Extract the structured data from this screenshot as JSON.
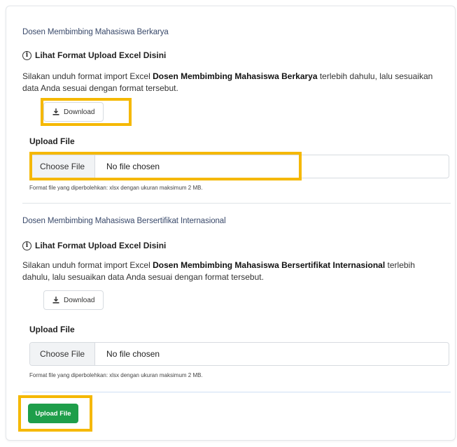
{
  "sections": [
    {
      "title": "Dosen Membimbing Mahasiswa Berkarya",
      "info_heading": "Lihat Format Upload Excel Disini",
      "desc_prefix": "Silakan unduh format import Excel ",
      "desc_bold": "Dosen Membimbing Mahasiswa Berkarya",
      "desc_suffix": " terlebih dahulu, lalu sesuaikan data Anda sesuai dengan format tersebut.",
      "download_label": "Download",
      "upload_label": "Upload File",
      "choose_label": "Choose File",
      "no_file_label": "No file chosen",
      "hint": "Format file yang diperbolehkan: xlsx dengan ukuran maksimum 2 MB."
    },
    {
      "title": "Dosen Membimbing Mahasiswa Bersertifikat Internasional",
      "info_heading": "Lihat Format Upload Excel Disini",
      "desc_prefix": "Silakan unduh format import Excel ",
      "desc_bold": "Dosen Membimbing Mahasiswa Bersertifikat Internasional",
      "desc_suffix": " terlebih dahulu, lalu sesuaikan data Anda sesuai dengan format tersebut.",
      "download_label": "Download",
      "upload_label": "Upload File",
      "choose_label": "Choose File",
      "no_file_label": "No file chosen",
      "hint": "Format file yang diperbolehkan: xlsx dengan ukuran maksimum 2 MB."
    }
  ],
  "submit_label": "Upload File",
  "colors": {
    "highlight": "#f5b800",
    "submit_green": "#1e9e4a",
    "title_blue": "#3a4a6b"
  },
  "icons": {
    "info": "info-circle-icon",
    "download": "download-icon"
  }
}
